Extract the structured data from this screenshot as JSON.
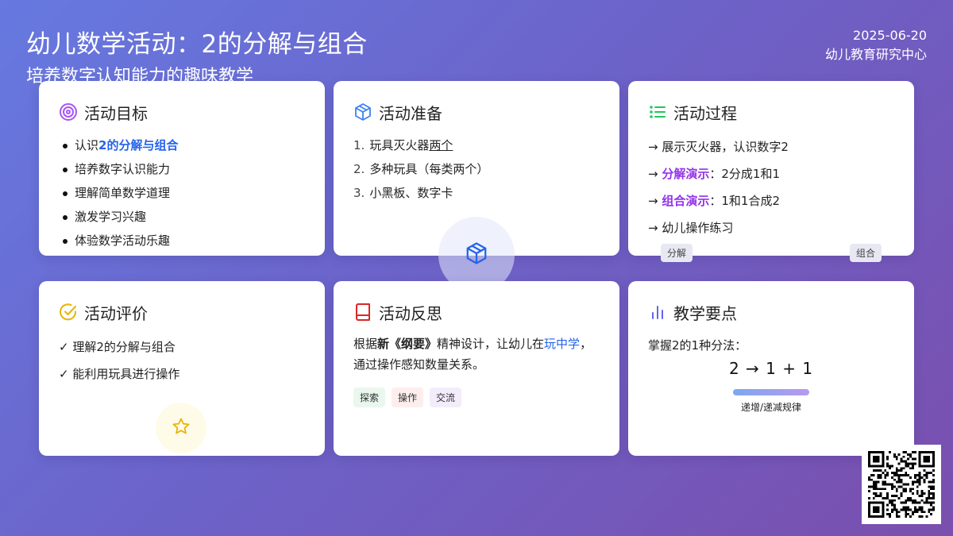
{
  "header": {
    "title": "幼儿数学活动：2的分解与组合",
    "subtitle": "培养数字认知能力的趣味教学",
    "date": "2025-06-20",
    "org": "幼儿教育研究中心"
  },
  "colors": {
    "bg_start": "#6679e0",
    "bg_end": "#7a4fae",
    "accent_blue": "#2563eb",
    "accent_purple": "#9333ea",
    "accent_green": "#22c55e",
    "accent_yellow": "#eab308",
    "accent_red": "#dc2626"
  },
  "cards": {
    "goals": {
      "icon": "target-icon",
      "title": "活动目标",
      "items": [
        {
          "prefix": "认识",
          "highlight": "2的分解与组合"
        },
        {
          "text": "培养数字认识能力"
        },
        {
          "text": "理解简单数学道理"
        },
        {
          "text": "激发学习兴趣"
        },
        {
          "text": "体验数学活动乐趣"
        }
      ]
    },
    "prep": {
      "icon": "box-icon",
      "title": "活动准备",
      "items": [
        {
          "num": "1.",
          "text_before": "玩具灭火器",
          "text_underlined": "两个",
          "text_after": ""
        },
        {
          "num": "2.",
          "text": "多种玩具（每类两个）"
        },
        {
          "num": "3.",
          "text": "小黑板、数字卡"
        }
      ]
    },
    "process": {
      "icon": "list-icon",
      "title": "活动过程",
      "steps": [
        {
          "arrow": "→",
          "text": "展示灭火器，认识数字2"
        },
        {
          "arrow": "→",
          "bold": "分解演示",
          "rest": "：2分成1和1"
        },
        {
          "arrow": "→",
          "bold": "组合演示",
          "rest": "：1和1合成2"
        },
        {
          "arrow": "→",
          "text": "幼儿操作练习"
        }
      ],
      "tag_left": "分解",
      "tag_right": "组合"
    },
    "evaluation": {
      "icon": "check-circle-icon",
      "title": "活动评价",
      "items": [
        {
          "mark": "✓",
          "text": "理解2的分解与组合"
        },
        {
          "mark": "✓",
          "text": "能利用玩具进行操作"
        }
      ],
      "decor_icon": "star-icon"
    },
    "reflection": {
      "icon": "book-icon",
      "title": "活动反思",
      "text_1": "根据",
      "bold": "新《纲要》",
      "text_2": "精神设计，让幼儿在",
      "highlight": "玩中学",
      "text_3": "，通过操作感知数量关系。",
      "tags": [
        {
          "label": "探索",
          "bg": "#eaf7ee"
        },
        {
          "label": "操作",
          "bg": "#fdeeee"
        },
        {
          "label": "交流",
          "bg": "#f3ecfb"
        }
      ]
    },
    "keypoints": {
      "icon": "bar-chart-icon",
      "title": "教学要点",
      "line": "掌握2的1种分法：",
      "formula": "2 → 1 + 1",
      "bar_label": "递增/递减规律"
    }
  },
  "qr": {
    "icon": "qr-code-icon"
  }
}
